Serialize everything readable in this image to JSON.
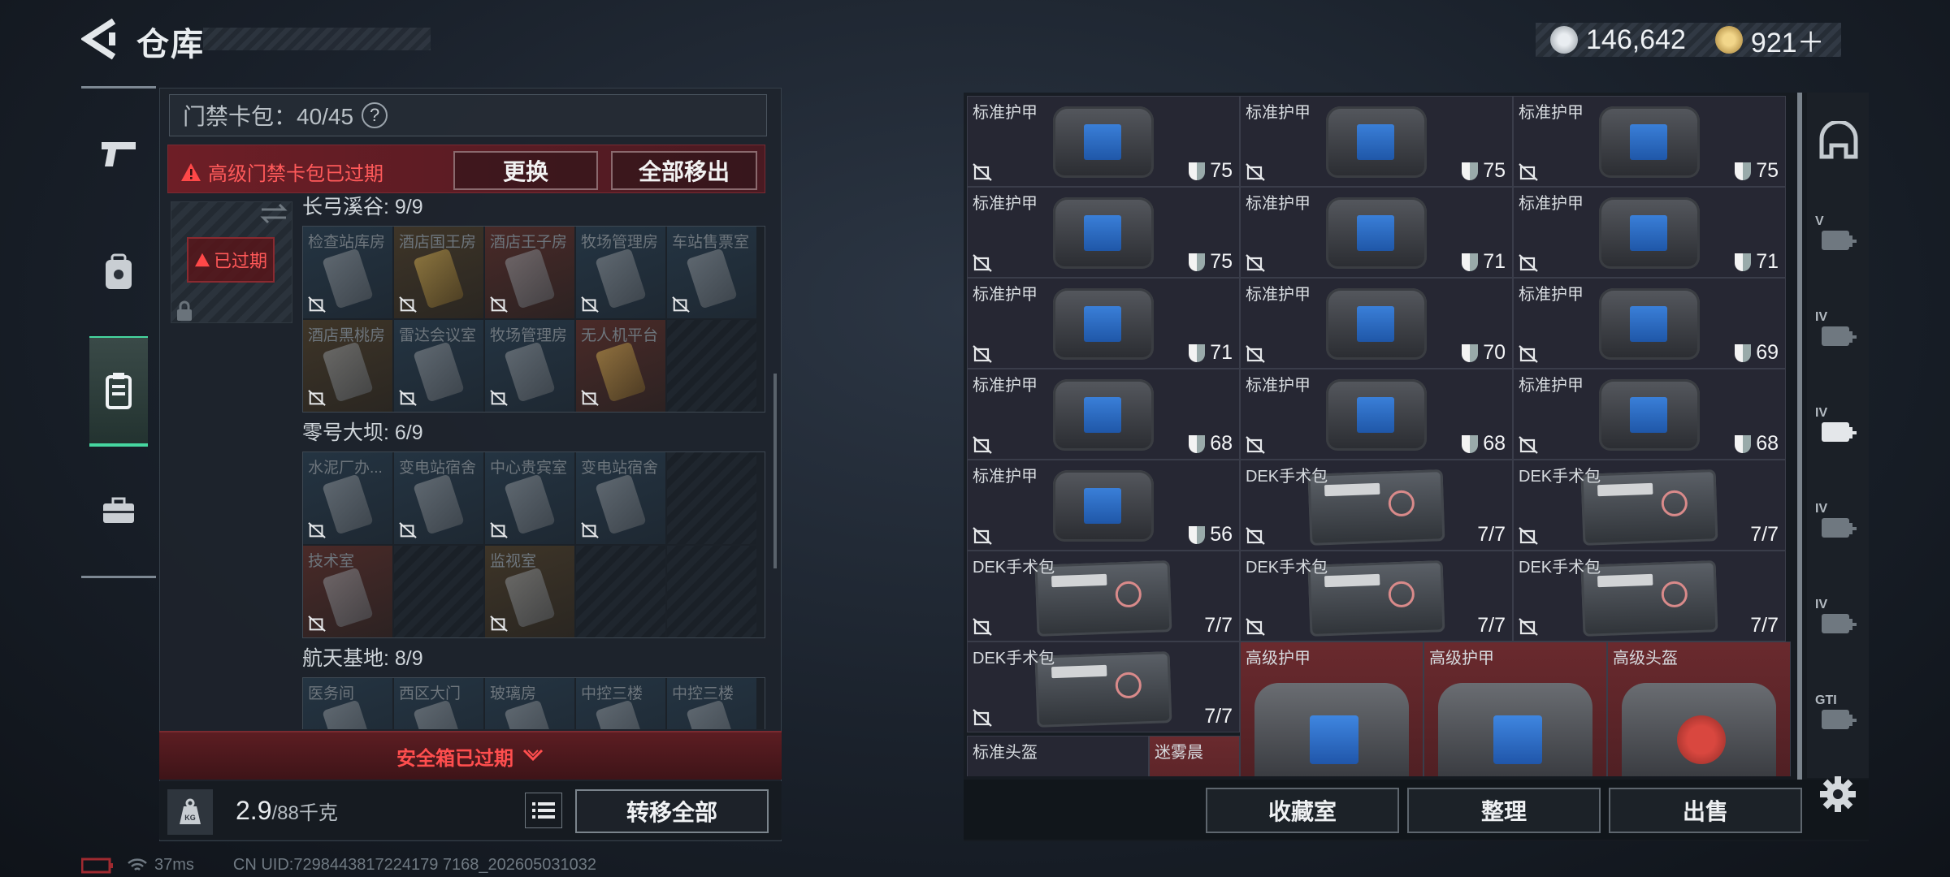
{
  "header": {
    "title": "仓库"
  },
  "currency": [
    {
      "icon": "silver-coin-icon",
      "value": "146,642"
    },
    {
      "icon": "gold-coin-icon",
      "value": "921＋"
    }
  ],
  "left_nav": [
    {
      "icon": "pistol-icon"
    },
    {
      "icon": "backpack-icon"
    },
    {
      "icon": "keycard-case-icon",
      "active": true
    },
    {
      "icon": "briefcase-icon"
    }
  ],
  "keycard": {
    "label": "门禁卡包：40/45",
    "help": "?",
    "warning": "高级门禁卡包已过期",
    "replace_label": "更换",
    "move_all_label": "全部移出",
    "expired_tag": "已过期"
  },
  "sections": [
    {
      "title": "长弓溪谷: 9/9",
      "rows": [
        [
          {
            "name": "检查站库房",
            "style": "blue"
          },
          {
            "name": "酒店国王房",
            "style": "brown",
            "gold": true
          },
          {
            "name": "酒店王子房",
            "style": "red"
          },
          {
            "name": "牧场管理房",
            "style": "blue"
          },
          {
            "name": "车站售票室",
            "style": "blue"
          }
        ],
        [
          {
            "name": "酒店黑桃房",
            "style": "brown"
          },
          {
            "name": "雷达会议室",
            "style": "blue"
          },
          {
            "name": "牧场管理房",
            "style": "blue"
          },
          {
            "name": "无人机平台",
            "style": "red",
            "gold": true
          },
          {
            "name": "",
            "style": "empty"
          }
        ]
      ]
    },
    {
      "title": "零号大坝: 6/9",
      "rows": [
        [
          {
            "name": "水泥厂办...",
            "style": "blue"
          },
          {
            "name": "变电站宿舍",
            "style": "blue"
          },
          {
            "name": "中心贵宾室",
            "style": "blue"
          },
          {
            "name": "变电站宿舍",
            "style": "blue"
          },
          {
            "name": "",
            "style": "empty"
          }
        ],
        [
          {
            "name": "技术室",
            "style": "red"
          },
          {
            "name": "",
            "style": "empty"
          },
          {
            "name": "监视室",
            "style": "brown"
          },
          {
            "name": "",
            "style": "empty"
          },
          {
            "name": "",
            "style": "empty"
          }
        ]
      ]
    },
    {
      "title": "航天基地: 8/9",
      "rows": [
        [
          {
            "name": "医务间",
            "style": "blue"
          },
          {
            "name": "西区大门",
            "style": "blue"
          },
          {
            "name": "玻璃房",
            "style": "blue"
          },
          {
            "name": "中控三楼",
            "style": "blue"
          },
          {
            "name": "中控三楼",
            "style": "blue"
          }
        ]
      ]
    }
  ],
  "safebox": {
    "label": "安全箱已过期"
  },
  "weight": {
    "value": "2.9",
    "unit": "/88千克"
  },
  "transfer_all_label": "转移全部",
  "status": {
    "ping": "37ms",
    "uid": "CN UID:7298443817224179 7168_202605031032"
  },
  "items": [
    {
      "name": "标准护甲",
      "kind": "armor",
      "value": "75"
    },
    {
      "name": "标准护甲",
      "kind": "armor",
      "value": "75"
    },
    {
      "name": "标准护甲",
      "kind": "armor",
      "value": "75"
    },
    {
      "name": "标准护甲",
      "kind": "armor",
      "value": "75"
    },
    {
      "name": "标准护甲",
      "kind": "armor",
      "value": "71"
    },
    {
      "name": "标准护甲",
      "kind": "armor",
      "value": "71"
    },
    {
      "name": "标准护甲",
      "kind": "armor",
      "value": "71"
    },
    {
      "name": "标准护甲",
      "kind": "armor",
      "value": "70"
    },
    {
      "name": "标准护甲",
      "kind": "armor",
      "value": "69"
    },
    {
      "name": "标准护甲",
      "kind": "armor",
      "value": "68"
    },
    {
      "name": "标准护甲",
      "kind": "armor",
      "value": "68"
    },
    {
      "name": "标准护甲",
      "kind": "armor",
      "value": "68"
    },
    {
      "name": "标准护甲",
      "kind": "armor",
      "value": "56"
    },
    {
      "name": "DEK手术包",
      "kind": "kit",
      "value": "7/7"
    },
    {
      "name": "DEK手术包",
      "kind": "kit",
      "value": "7/7"
    },
    {
      "name": "DEK手术包",
      "kind": "kit",
      "value": "7/7"
    },
    {
      "name": "DEK手术包",
      "kind": "kit",
      "value": "7/7"
    },
    {
      "name": "DEK手术包",
      "kind": "kit",
      "value": "7/7"
    },
    {
      "name": "DEK手术包",
      "kind": "kit",
      "value": "7/7"
    }
  ],
  "large_items": [
    {
      "name": "高级护甲",
      "kind": "armor"
    },
    {
      "name": "高级护甲",
      "kind": "armor"
    },
    {
      "name": "高级头盔",
      "kind": "helmet"
    }
  ],
  "bottom_items": [
    {
      "name": "标准头盔"
    },
    {
      "name": "迷雾晨"
    }
  ],
  "right_buttons": {
    "collection": "收藏室",
    "sort": "整理",
    "sell": "出售"
  },
  "right_nav": [
    {
      "icon": "helmet-slot-icon",
      "level": ""
    },
    {
      "icon": "armor-slot-icon",
      "level": "V"
    },
    {
      "icon": "medkit-slot-icon",
      "level": "IV"
    },
    {
      "icon": "medkit-slot-icon",
      "level": "IV"
    },
    {
      "icon": "medkit-slot-icon",
      "level": "IV"
    },
    {
      "icon": "weapon-slot-icon",
      "level": "IV"
    },
    {
      "icon": "gt-slot-icon",
      "level": "GTI"
    }
  ],
  "colors": {
    "accent": "#46d7a0",
    "warning": "#ff4e4e",
    "panel": "#1e242c"
  }
}
